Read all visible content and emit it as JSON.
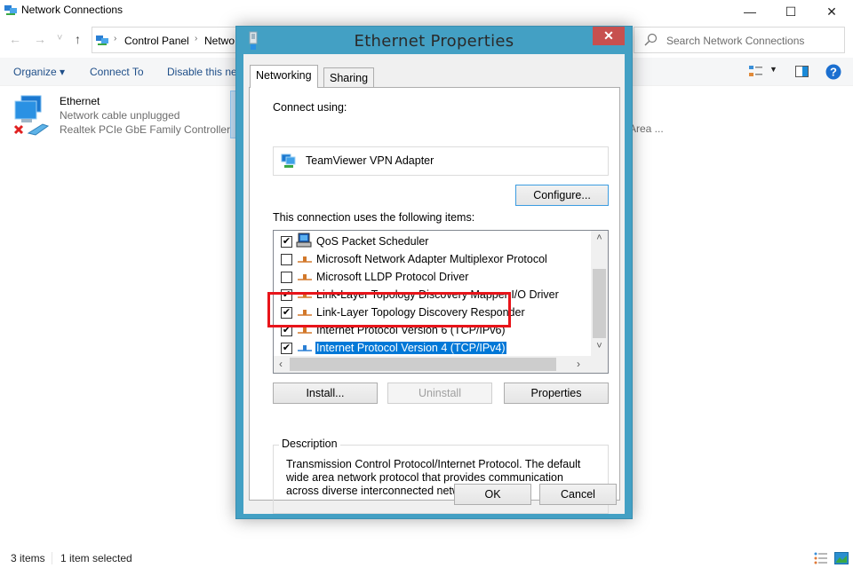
{
  "explorer": {
    "window_title": "Network Connections",
    "window_controls": {
      "minimize": "—",
      "maximize": "☐",
      "close": "✕"
    },
    "nav": {
      "back": "←",
      "forward": "→",
      "recent": "˅",
      "up": "↑"
    },
    "breadcrumb": [
      "Control Panel",
      "Netwo"
    ],
    "search_placeholder": "Search Network Connections",
    "ribbon": {
      "organize": "Organize ▾",
      "connect_to": "Connect To",
      "disable": "Disable this net"
    },
    "items": [
      {
        "name": "Ethernet",
        "status": "Network cable unplugged",
        "device": "Realtek PCIe GbE Family Controller"
      }
    ],
    "partial_item_text": "Area ...",
    "status": {
      "count": "3 items",
      "selected": "1 item selected"
    }
  },
  "dialog": {
    "title": "Ethernet Properties",
    "close": "✕",
    "tabs": [
      {
        "label": "Networking",
        "active": true
      },
      {
        "label": "Sharing",
        "active": false
      }
    ],
    "connect_using_label": "Connect using:",
    "adapter_name": "TeamViewer VPN Adapter",
    "configure_button": "Configure...",
    "items_label": "This connection uses the following items:",
    "items": [
      {
        "label": "QoS Packet Scheduler",
        "checked": true,
        "icon": "qos-icon",
        "selected": false
      },
      {
        "label": "Microsoft Network Adapter Multiplexor Protocol",
        "checked": false,
        "icon": "protocol-icon",
        "selected": false
      },
      {
        "label": "Microsoft LLDP Protocol Driver",
        "checked": false,
        "icon": "protocol-icon",
        "selected": false
      },
      {
        "label": "Link-Layer Topology Discovery Mapper I/O Driver",
        "checked": true,
        "icon": "protocol-icon",
        "selected": false
      },
      {
        "label": "Link-Layer Topology Discovery Responder",
        "checked": true,
        "icon": "protocol-icon",
        "selected": false
      },
      {
        "label": "Internet Protocol Version 6 (TCP/IPv6)",
        "checked": true,
        "icon": "protocol-icon",
        "selected": false
      },
      {
        "label": "Internet Protocol Version 4 (TCP/IPv4)",
        "checked": true,
        "icon": "protocol-icon",
        "selected": true
      }
    ],
    "install_button": "Install...",
    "uninstall_button": "Uninstall",
    "properties_button": "Properties",
    "description_legend": "Description",
    "description_text": "Transmission Control Protocol/Internet Protocol. The default wide area network protocol that provides communication across diverse interconnected networks.",
    "ok_button": "OK",
    "cancel_button": "Cancel"
  },
  "colors": {
    "dialog_frame": "#43a0c4",
    "close_button": "#c7504f",
    "selection": "#0078d7",
    "highlight_annotation": "#e8141a",
    "ribbon_text": "#1f4f89"
  }
}
